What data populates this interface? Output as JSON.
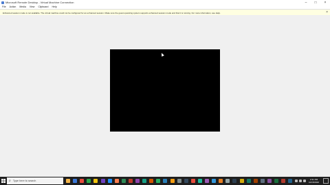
{
  "window": {
    "title": "Microsoft Remote Desktop - Virtual Machine Connection",
    "minimize_glyph": "–",
    "maximize_glyph": "□",
    "close_glyph": "×"
  },
  "menu": {
    "items": [
      "File",
      "Action",
      "Media",
      "View",
      "Clipboard",
      "Help"
    ]
  },
  "infobar": {
    "text": "Enhanced session mode is not available. The virtual machine could not be configured for an enhanced session. Make sure the guest operating system supports enhanced session mode and that it is running. For more information, see Help.",
    "close_glyph": "×"
  },
  "taskbar": {
    "search_placeholder": "Type here to search",
    "clock_time": "2:31 PM",
    "clock_date": "10/15/2020",
    "pinned_colors": [
      "#f3b54a",
      "#3b78d8",
      "#e84c3d",
      "#2aa84a",
      "#f1c40f",
      "#6f42c1",
      "#1e90ff",
      "#ff7f50",
      "#2e8b57",
      "#c0392b",
      "#8e44ad",
      "#16a085",
      "#d35400",
      "#27ae60",
      "#2980b9",
      "#f39c12",
      "#7f8c8d",
      "#34495e",
      "#e74c3c",
      "#1abc9c",
      "#9b59b6",
      "#3498db",
      "#e67e22",
      "#95a5a6",
      "#2c3e50",
      "#d4ac0d",
      "#117a65",
      "#a04000",
      "#5d6d7e",
      "#884ea0",
      "#196f3d",
      "#b03a2e",
      "#21618c"
    ]
  }
}
